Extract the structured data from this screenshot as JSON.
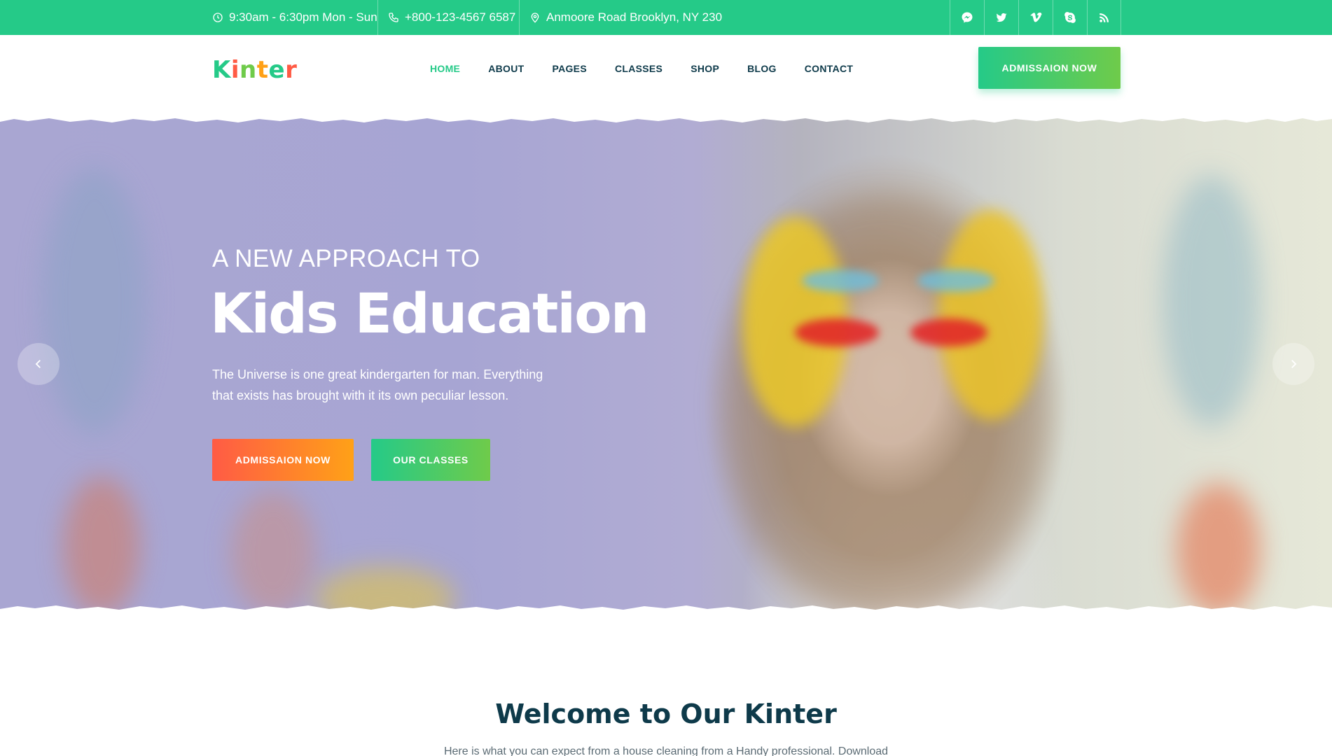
{
  "topbar": {
    "hours": "9:30am - 6:30pm Mon - Sun",
    "phone": "+800-123-4567 6587",
    "address": "Anmoore Road Brooklyn, NY 230",
    "social_icons": [
      "messenger-icon",
      "twitter-icon",
      "vimeo-icon",
      "skype-icon",
      "rss-icon"
    ],
    "background_color": "#25ca88"
  },
  "header": {
    "logo_letters": [
      "K",
      "i",
      "n",
      "t",
      "e",
      "r"
    ],
    "logo_colors": [
      "#25ca88",
      "#ff5b45",
      "#6fcb4a",
      "#ffa117",
      "#25ca88",
      "#ff5b45"
    ],
    "nav": [
      {
        "label": "HOME",
        "active": true
      },
      {
        "label": "ABOUT",
        "active": false
      },
      {
        "label": "PAGES",
        "active": false
      },
      {
        "label": "CLASSES",
        "active": false
      },
      {
        "label": "SHOP",
        "active": false
      },
      {
        "label": "BLOG",
        "active": false
      },
      {
        "label": "CONTACT",
        "active": false
      }
    ],
    "cta_label": "ADMISSAION NOW",
    "accent_color": "#25ca88",
    "nav_text_color": "#0e3a4a"
  },
  "hero": {
    "pretitle": "A NEW APPROACH TO",
    "title": "Kids Education",
    "text": "The Universe is one great kindergarten for man. Everything that exists has brought with it its own peculiar lesson.",
    "primary_button": "ADMISSAION NOW",
    "secondary_button": "OUR CLASSES",
    "prev_icon": "chevron-left-icon",
    "next_icon": "chevron-right-icon"
  },
  "welcome": {
    "title": "Welcome to Our Kinter",
    "text": "Here is what you can expect from a house cleaning from a Handy professional. Download"
  }
}
